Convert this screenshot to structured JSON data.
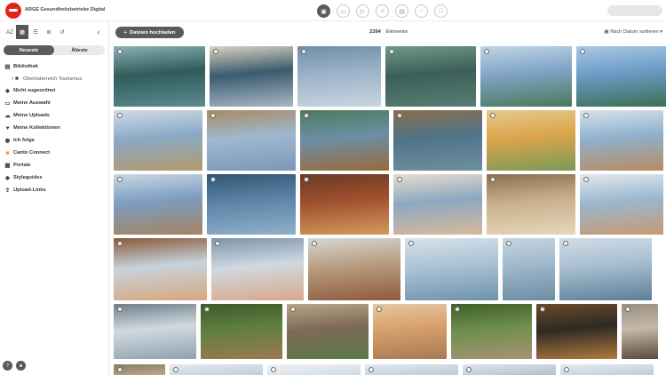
{
  "header": {
    "brand": "ARGE Gesundheitsbetriebe Digital",
    "apps": [
      {
        "name": "library-app-icon",
        "glyph": "▣",
        "active": true
      },
      {
        "name": "images-app-icon",
        "glyph": "▭",
        "active": false
      },
      {
        "name": "video-app-icon",
        "glyph": "▷",
        "active": false
      },
      {
        "name": "audio-app-icon",
        "glyph": "♫",
        "active": false
      },
      {
        "name": "document-app-icon",
        "glyph": "▤",
        "active": false
      },
      {
        "name": "chat-app-icon",
        "glyph": "◌",
        "active": false
      },
      {
        "name": "page-app-icon",
        "glyph": "□",
        "active": false
      }
    ]
  },
  "sidebar": {
    "tools": [
      {
        "name": "az-sort-button",
        "glyph": "AZ",
        "active": false
      },
      {
        "name": "calendar-view-button",
        "glyph": "▦",
        "active": true
      },
      {
        "name": "list-view-button",
        "glyph": "☰",
        "active": false
      },
      {
        "name": "table-view-button",
        "glyph": "≣",
        "active": false
      },
      {
        "name": "history-button",
        "glyph": "↺",
        "active": false
      }
    ],
    "collapse_glyph": "‹",
    "tabs": {
      "newest": "Neueste",
      "oldest": "Älteste"
    },
    "items": [
      {
        "label": "Bibliothek",
        "icon": "▤",
        "sub": false
      },
      {
        "label": "Oberösterreich Tourismus",
        "icon": "› ■",
        "sub": true
      },
      {
        "label": "Nicht zugeordnet",
        "icon": "◈",
        "sub": false
      },
      {
        "label": "Meine Auswahl",
        "icon": "▭",
        "sub": false
      },
      {
        "label": "Meine Uploads",
        "icon": "☁",
        "sub": false
      },
      {
        "label": "Meine Kollektionen",
        "icon": "♥",
        "sub": false
      },
      {
        "label": "Ich folge",
        "icon": "◉",
        "sub": false
      },
      {
        "label": "Canto Connect",
        "icon": "■",
        "sub": false
      },
      {
        "label": "Portale",
        "icon": "▦",
        "sub": false
      },
      {
        "label": "Styleguides",
        "icon": "◆",
        "sub": false
      },
      {
        "label": "Upload-Links",
        "icon": "⇪",
        "sub": false
      }
    ]
  },
  "toolbar": {
    "upload_label": "Dateien hochladen",
    "count_value": "2264",
    "count_label": "Elemente",
    "sort_label": "Nach Datum sortieren"
  },
  "thumbnails": [
    {
      "row": 0,
      "colors": [
        "#2f5c5a",
        "#5d8b8f",
        "#8bb0b6"
      ]
    },
    {
      "row": 0,
      "colors": [
        "#3a5b6e",
        "#a7b7c4",
        "#d9d2be"
      ]
    },
    {
      "row": 0,
      "colors": [
        "#9bb3c9",
        "#c9d6e0",
        "#6f8fa6"
      ]
    },
    {
      "row": 0,
      "colors": [
        "#3c5f57",
        "#587f74",
        "#6f9a8c"
      ]
    },
    {
      "row": 0,
      "colors": [
        "#7fa3c4",
        "#4a7a59",
        "#c1d4e6"
      ]
    },
    {
      "row": 0,
      "colors": [
        "#6a9bc6",
        "#3d6f55",
        "#a9c8e4"
      ]
    },
    {
      "row": 1,
      "colors": [
        "#8aa9c5",
        "#b49a6c",
        "#cfdbe6"
      ]
    },
    {
      "row": 1,
      "colors": [
        "#9fb8d0",
        "#7b98b6",
        "#a68c63"
      ]
    },
    {
      "row": 1,
      "colors": [
        "#6a8fa6",
        "#9b6a3b",
        "#4e7a5c"
      ]
    },
    {
      "row": 1,
      "colors": [
        "#4f7488",
        "#6e8f9f",
        "#8a6e4c"
      ]
    },
    {
      "row": 1,
      "colors": [
        "#d9a54b",
        "#7b9a58",
        "#e6c98b"
      ]
    },
    {
      "row": 1,
      "colors": [
        "#8fb0cd",
        "#b88c62",
        "#d7e3ec"
      ]
    },
    {
      "row": 2,
      "colors": [
        "#7c9cbf",
        "#a48561",
        "#c8d7e4"
      ]
    },
    {
      "row": 2,
      "colors": [
        "#5d84a8",
        "#8fb0c9",
        "#2f5670"
      ]
    },
    {
      "row": 2,
      "colors": [
        "#a0512f",
        "#d49a5b",
        "#6b3a22"
      ]
    },
    {
      "row": 2,
      "colors": [
        "#8da8c2",
        "#d7b99a",
        "#e7dccd"
      ]
    },
    {
      "row": 2,
      "colors": [
        "#c9b08b",
        "#e6d7bd",
        "#8b6f50"
      ]
    },
    {
      "row": 2,
      "colors": [
        "#9ab7cf",
        "#c79a72",
        "#e3e8ec"
      ]
    },
    {
      "row": 3,
      "colors": [
        "#c7d3dc",
        "#d8a77c",
        "#8a5a3a"
      ]
    },
    {
      "row": 3,
      "colors": [
        "#cfd9e1",
        "#d9a88a",
        "#7d95aa"
      ]
    },
    {
      "row": 3,
      "colors": [
        "#b79c80",
        "#8f5a3d",
        "#d7d7d0"
      ]
    },
    {
      "row": 3,
      "colors": [
        "#a9c2d4",
        "#6f93ad",
        "#d8e2ea"
      ]
    },
    {
      "row": 3,
      "colors": [
        "#9db7cb",
        "#6e8da4",
        "#c7d5df"
      ]
    },
    {
      "row": 3,
      "colors": [
        "#a6bdcf",
        "#5e7f97",
        "#d2dde6"
      ]
    },
    {
      "row": 4,
      "colors": [
        "#d2d9de",
        "#8fa2b1",
        "#6e7f8b"
      ]
    },
    {
      "row": 4,
      "colors": [
        "#5f7f3f",
        "#9b7a4f",
        "#3d5a2a"
      ]
    },
    {
      "row": 4,
      "colors": [
        "#7d6a55",
        "#5b7a49",
        "#b8a58a"
      ]
    },
    {
      "row": 4,
      "colors": [
        "#d6a06a",
        "#a77a55",
        "#e6c7a3"
      ]
    },
    {
      "row": 4,
      "colors": [
        "#6d8f4a",
        "#a89277",
        "#3f5f2c"
      ]
    },
    {
      "row": 4,
      "colors": [
        "#2f2a24",
        "#b07a3e",
        "#6a4a2a"
      ]
    },
    {
      "row": 4,
      "colors": [
        "#c4b8a8",
        "#5d4a3a",
        "#9b8f80"
      ]
    },
    {
      "row": 5,
      "colors": [
        "#b8a58a",
        "#d8cbb8",
        "#8a7a66"
      ]
    },
    {
      "row": 5,
      "colors": [
        "#c7d3de",
        "#9fb2c3",
        "#e3e9ee"
      ]
    },
    {
      "row": 5,
      "colors": [
        "#d8e0e6",
        "#a7b5c1",
        "#eef1f3"
      ]
    },
    {
      "row": 5,
      "colors": [
        "#c3cfda",
        "#a2b4c4",
        "#e2e8ed"
      ]
    },
    {
      "row": 5,
      "colors": [
        "#b9c7d3",
        "#9aabbb",
        "#dde4ea"
      ]
    },
    {
      "row": 5,
      "colors": [
        "#c6d2dc",
        "#a5b6c5",
        "#e4e9ee"
      ]
    }
  ]
}
